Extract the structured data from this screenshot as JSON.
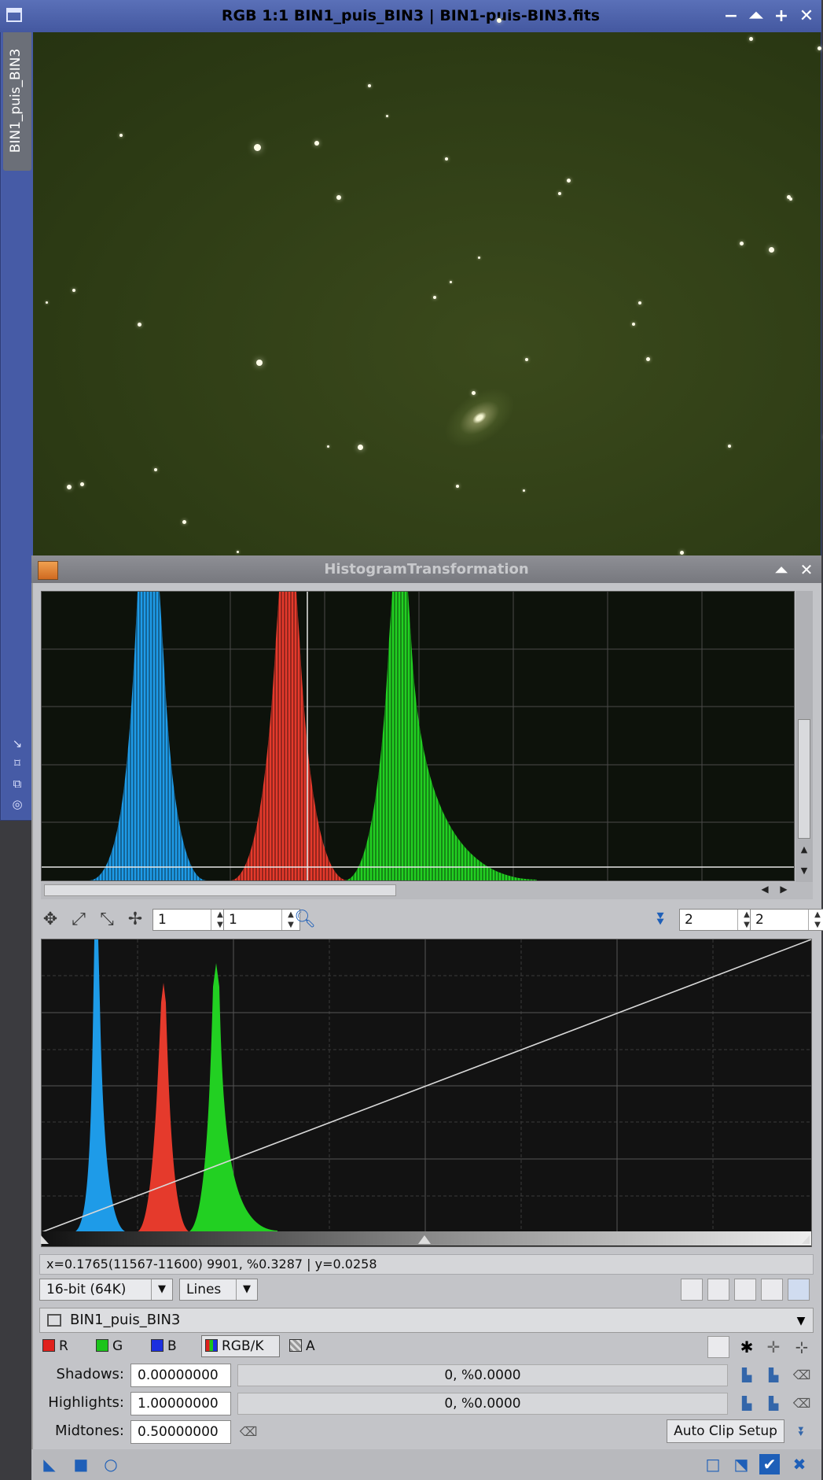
{
  "image_window": {
    "title": "RGB 1:1 BIN1_puis_BIN3 | BIN1-puis-BIN3.fits",
    "view_tab": "BIN1_puis_BIN3",
    "title_buttons": {
      "minimize": "−",
      "shade": "⏶",
      "maximize": "+",
      "close": "✕"
    }
  },
  "histogram_panel": {
    "title": "HistogramTransformation",
    "title_buttons": {
      "shade": "⏶",
      "close": "✕"
    },
    "zoom": {
      "horizontal": "1",
      "vertical": "1"
    },
    "curve_zoom": {
      "horizontal": "2",
      "vertical": "2"
    },
    "readout": "x=0.1765(11567-11600) 9901, %0.3287 | y=0.0258",
    "resolution_option": "16-bit (64K)",
    "graph_style_option": "Lines",
    "target_view": "BIN1_puis_BIN3",
    "channels": [
      {
        "label": "R",
        "color": "#e0211c"
      },
      {
        "label": "G",
        "color": "#1bc41b"
      },
      {
        "label": "B",
        "color": "#1c2fe0"
      },
      {
        "label": "RGB/K",
        "color": "#555555"
      },
      {
        "label": "A",
        "color": "#888888"
      }
    ],
    "shadows": {
      "label": "Shadows:",
      "value": "0.00000000",
      "clipped": "0, %0.0000"
    },
    "highlights": {
      "label": "Highlights:",
      "value": "1.00000000",
      "clipped": "0, %0.0000"
    },
    "midtones": {
      "label": "Midtones:",
      "value": "0.50000000"
    },
    "auto_clip_label": "Auto Clip Setup",
    "histogram_colors": {
      "blue": "#1e9be8",
      "red": "#e53a2c",
      "green": "#22d022"
    }
  }
}
